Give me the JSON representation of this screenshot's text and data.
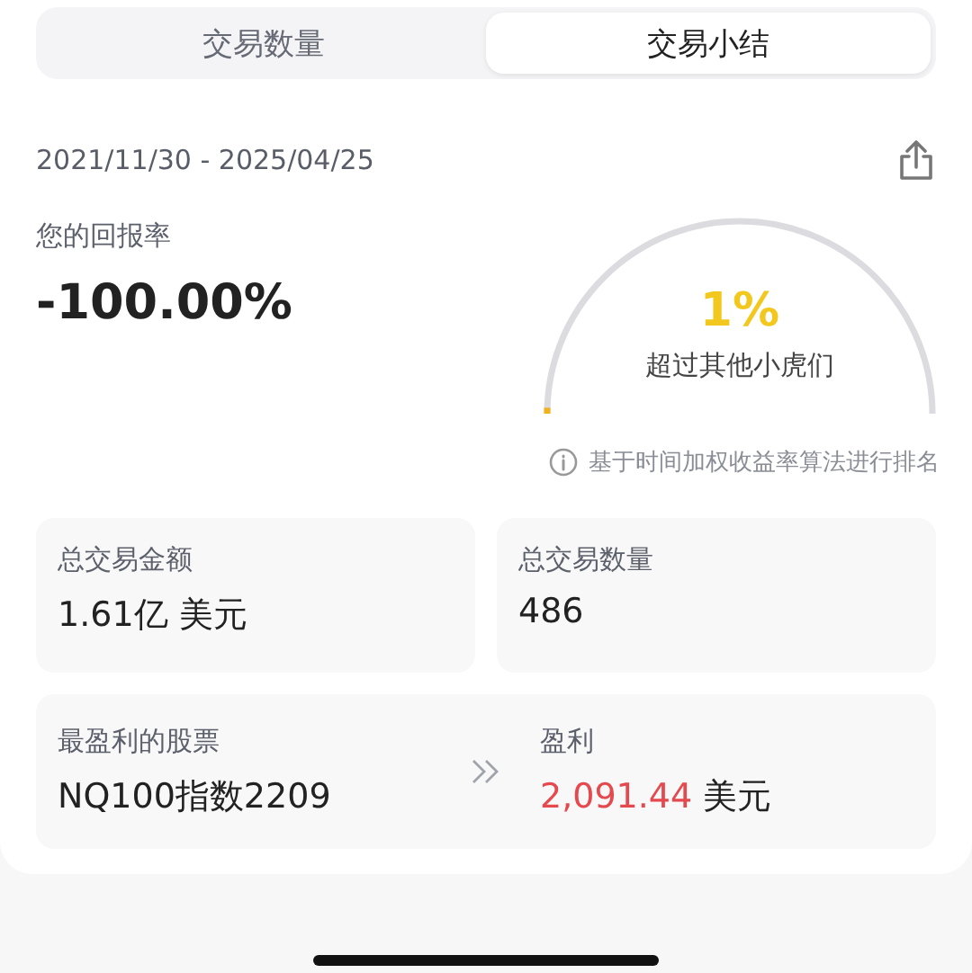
{
  "tabs": [
    {
      "label": "交易数量",
      "selected": false
    },
    {
      "label": "交易小结",
      "selected": true
    }
  ],
  "date_range": "2021/11/30 - 2025/04/25",
  "return": {
    "label": "您的回报率",
    "value": "-100.00%"
  },
  "rank": {
    "percent": "1%",
    "caption": "超过其他小虎们",
    "note": "基于时间加权收益率算法进行排名"
  },
  "stats": [
    {
      "label": "总交易金额",
      "value": "1.61亿 美元"
    },
    {
      "label": "总交易数量",
      "value": "486"
    }
  ],
  "best_stock": {
    "label": "最盈利的股票",
    "name": "NQ100指数2209",
    "profit_label": "盈利",
    "profit_amount": "2,091.44",
    "profit_unit": "美元"
  }
}
